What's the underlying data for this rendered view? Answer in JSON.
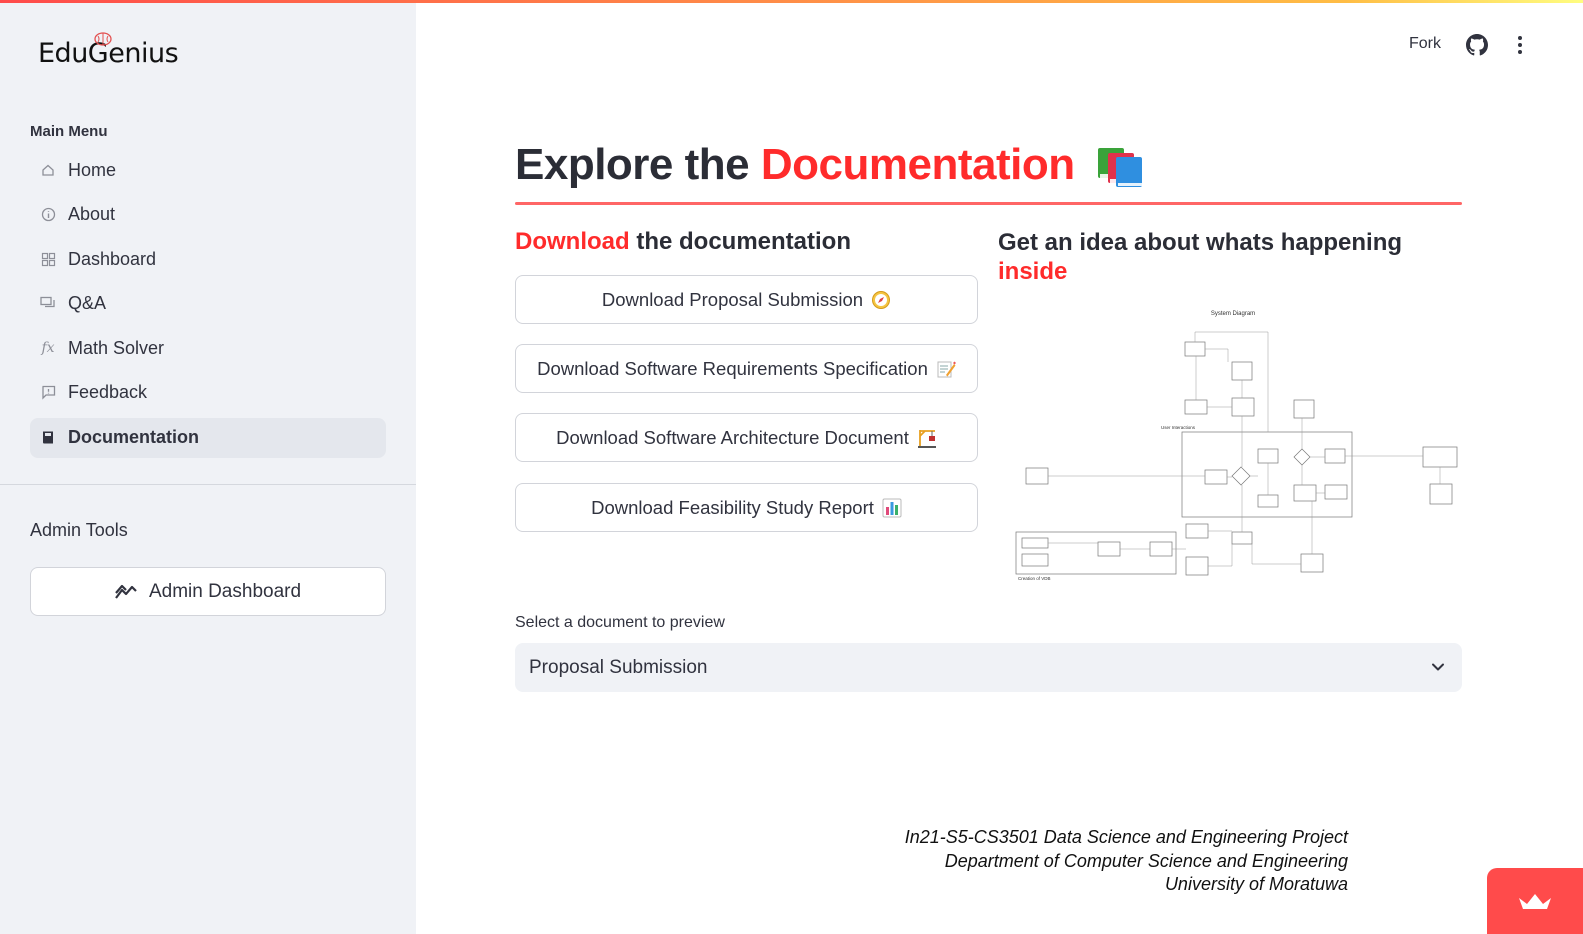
{
  "app": {
    "name": "EduGenius"
  },
  "sidebar": {
    "menu_title": "Main Menu",
    "items": [
      {
        "label": "Home",
        "icon": "home-icon",
        "active": false
      },
      {
        "label": "About",
        "icon": "info-icon",
        "active": false
      },
      {
        "label": "Dashboard",
        "icon": "dashboard-icon",
        "active": false
      },
      {
        "label": "Q&A",
        "icon": "chat-icon",
        "active": false
      },
      {
        "label": "Math Solver",
        "icon": "function-icon",
        "active": false
      },
      {
        "label": "Feedback",
        "icon": "feedback-icon",
        "active": false
      },
      {
        "label": "Documentation",
        "icon": "book-icon",
        "active": true
      }
    ],
    "admin_title": "Admin Tools",
    "admin_button": "Admin Dashboard"
  },
  "header": {
    "fork_label": "Fork"
  },
  "main": {
    "title_prefix": "Explore the ",
    "title_highlight": "Documentation",
    "download_section": {
      "highlight": "Download",
      "rest": " the documentation"
    },
    "diagram_section": {
      "rest": "Get an idea about whats happening ",
      "highlight": "inside"
    },
    "download_buttons": [
      {
        "label": "Download Proposal Submission",
        "emoji": "compass"
      },
      {
        "label": "Download Software Requirements Specification",
        "emoji": "memo"
      },
      {
        "label": "Download Software Architecture Document",
        "emoji": "construction"
      },
      {
        "label": "Download Feasibility Study Report",
        "emoji": "bar-chart"
      }
    ],
    "diagram": {
      "title": "System Diagram",
      "user_interactions": "User Interactions",
      "creation_label": "Creation of VDB"
    },
    "select": {
      "label": "Select a document to preview",
      "value": "Proposal Submission"
    }
  },
  "footer": {
    "line1": "In21-S5-CS3501 Data Science and Engineering Project",
    "line2": "Department of Computer Science and Engineering",
    "line3": "University of Moratuwa"
  },
  "colors": {
    "accent": "#ff4b4b",
    "sidebar_bg": "#f0f2f6",
    "text": "#31333f"
  }
}
